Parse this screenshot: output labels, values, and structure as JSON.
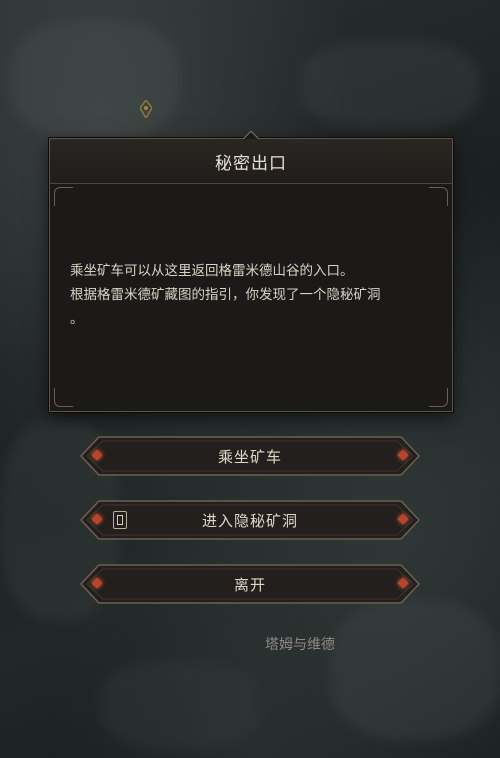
{
  "dialog": {
    "title": "秘密出口",
    "body_line1": "乘坐矿车可以从这里返回格雷米德山谷的入口。",
    "body_line2": "根据格雷米德矿藏图的指引，你发现了一个隐秘矿洞",
    "body_line3": "。"
  },
  "options": [
    {
      "label": "乘坐矿车"
    },
    {
      "label": "进入隐秘矿洞"
    },
    {
      "label": "离开"
    }
  ],
  "map": {
    "label": "塔姆与维德"
  },
  "colors": {
    "accent_gem": "#b6452c",
    "panel_border": "#5d544a",
    "text": "#e0d6c4"
  }
}
